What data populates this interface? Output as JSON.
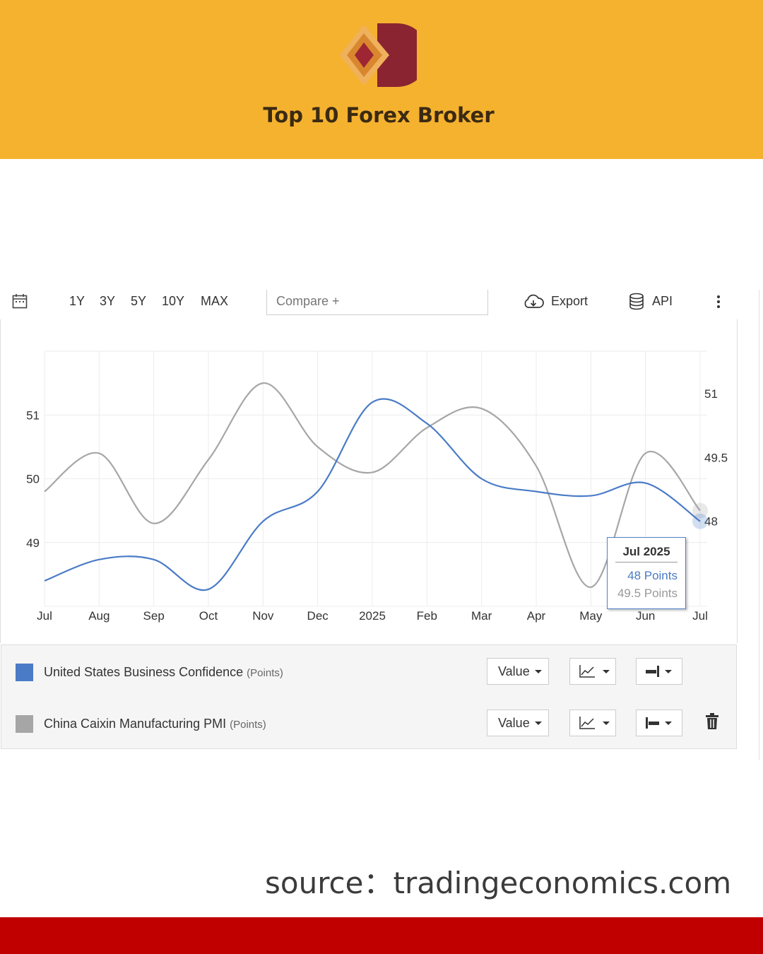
{
  "brand": {
    "title": "Top 10 Forex Broker",
    "color": "#f5b22f",
    "logo_colors": [
      "#e29a38",
      "#8b2431"
    ]
  },
  "toolbar": {
    "calendar_icon": "calendar-icon",
    "ranges": [
      "1Y",
      "3Y",
      "5Y",
      "10Y",
      "MAX"
    ],
    "compare_placeholder": "Compare +",
    "export_label": "Export",
    "export_icon": "cloud-download-icon",
    "api_label": "API",
    "api_icon": "database-icon",
    "more_icon": "vertical-dots-icon"
  },
  "chart_data": {
    "type": "line",
    "x": [
      "Jul",
      "Aug",
      "Sep",
      "Oct",
      "Nov",
      "Dec",
      "2025",
      "Feb",
      "Mar",
      "Apr",
      "May",
      "Jun",
      "Jul"
    ],
    "left_axis": {
      "ticks": [
        "51",
        "50",
        "49"
      ],
      "ylim": [
        48,
        52
      ]
    },
    "right_axis": {
      "ticks": [
        "51",
        "49.5",
        "48"
      ],
      "ylim": [
        46,
        52
      ]
    },
    "grid": true,
    "series": [
      {
        "name": "United States Business Confidence",
        "unit": "(Points)",
        "axis": "right",
        "color": "#4a7bc6",
        "values": [
          46.6,
          47.1,
          47.1,
          46.4,
          48.0,
          48.7,
          50.8,
          50.3,
          49.0,
          48.7,
          48.6,
          48.9,
          48.0
        ]
      },
      {
        "name": "China Caixin Manufacturing PMI",
        "unit": "(Points)",
        "axis": "left",
        "color": "#a6a6a6",
        "values": [
          49.8,
          50.4,
          49.3,
          50.3,
          51.5,
          50.5,
          50.1,
          50.8,
          51.1,
          50.2,
          48.3,
          50.4,
          49.5
        ]
      }
    ],
    "tooltip": {
      "date": "Jul 2025",
      "values": [
        "48 Points",
        "49.5 Points"
      ]
    }
  },
  "legend": {
    "value_label": "Value",
    "chart_type_icon": "line-chart-icon",
    "axis_right_icon": "axis-right-icon",
    "axis_left_icon": "axis-left-icon",
    "delete_icon": "trash-icon"
  },
  "source": "source：tradingeconomics.com",
  "bottom_bar_color": "#c00000"
}
